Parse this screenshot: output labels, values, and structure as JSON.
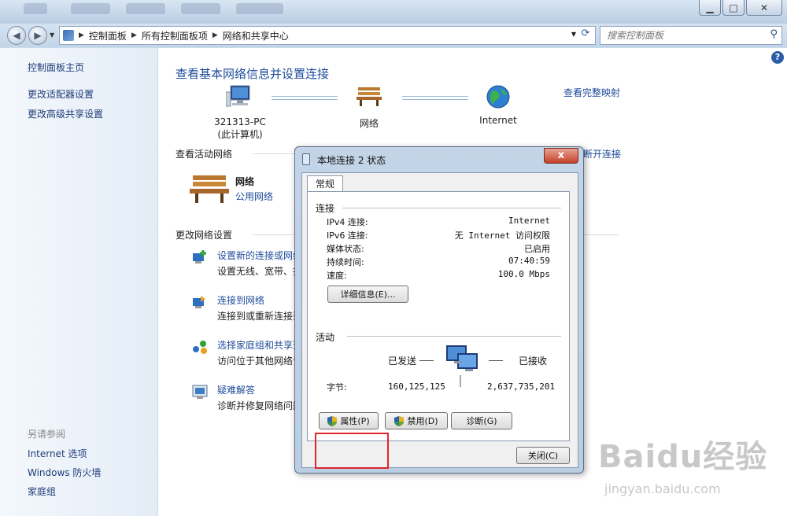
{
  "window": {
    "min": "▁",
    "max": "□",
    "close": "✕"
  },
  "address": {
    "crumbs": [
      "控制面板",
      "所有控制面板项",
      "网络和共享中心"
    ],
    "search_placeholder": "搜索控制面板"
  },
  "sidebar": {
    "items": [
      "控制面板主页",
      "更改适配器设置",
      "更改高级共享设置"
    ],
    "see_also_title": "另请参阅",
    "see_also": [
      "Internet 选项",
      "Windows 防火墙",
      "家庭组"
    ]
  },
  "main": {
    "title": "查看基本网络信息并设置连接",
    "full_map_link": "查看完整映射",
    "map": {
      "computer_name": "321313-PC",
      "computer_sub": "(此计算机)",
      "network": "网络",
      "internet": "Internet"
    },
    "active_section": "查看活动网络",
    "disconnect_link": "断开连接",
    "active_network": {
      "name": "网络",
      "type": "公用网络"
    },
    "change_section": "更改网络设置",
    "tasks": [
      {
        "title": "设置新的连接或网络",
        "desc": "设置无线、宽带、拨"
      },
      {
        "title": "连接到网络",
        "desc": "连接到或重新连接到"
      },
      {
        "title": "选择家庭组和共享选",
        "desc": "访问位于其他网络计"
      },
      {
        "title": "疑难解答",
        "desc": "诊断并修复网络问题"
      }
    ]
  },
  "dialog": {
    "title": "本地连接 2 状态",
    "close": "x",
    "tab": "常规",
    "connection_group": "连接",
    "rows": [
      {
        "key": "IPv4 连接:",
        "value": "Internet"
      },
      {
        "key": "IPv6 连接:",
        "value": "无 Internet 访问权限"
      },
      {
        "key": "媒体状态:",
        "value": "已启用"
      },
      {
        "key": "持续时间:",
        "value": "07:40:59"
      },
      {
        "key": "速度:",
        "value": "100.0 Mbps"
      }
    ],
    "details_button": "详细信息(E)...",
    "activity_group": "活动",
    "sent_label": "已发送",
    "received_label": "已接收",
    "bytes_label": "字节:",
    "bytes_sent": "160,125,125",
    "bytes_received": "2,637,735,201",
    "properties_button": "属性(P)",
    "disable_button": "禁用(D)",
    "diagnose_button": "诊断(G)",
    "close_button": "关闭(C)"
  },
  "watermark": {
    "brand": "Baidu经验",
    "url": "jingyan.baidu.com"
  }
}
